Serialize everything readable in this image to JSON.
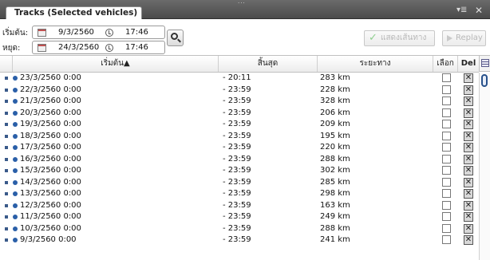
{
  "window": {
    "tab_title": "Tracks (Selected vehicles)",
    "grip": "...",
    "tab_menu_icon": "▾≣",
    "close_icon": "✕"
  },
  "filter": {
    "start_label": "เริ่มต้น:",
    "start_date": "9/3/2560",
    "start_time": "17:46",
    "end_label": "หยุด:",
    "end_date": "24/3/2560",
    "end_time": "17:46"
  },
  "toolbar": {
    "show_path_label": "แสดงเส้นทาง",
    "replay_label": "Replay"
  },
  "grid": {
    "columns": {
      "start": "เริ่มต้น▲",
      "end": "สิ้นสุด",
      "distance": "ระยะทาง",
      "select": "เลือก",
      "delete": "Del"
    },
    "del_glyph": "✕",
    "rows": [
      {
        "start": "23/3/2560 0:00",
        "end": "- 20:11",
        "distance": "283 km"
      },
      {
        "start": "22/3/2560 0:00",
        "end": "- 23:59",
        "distance": "228 km"
      },
      {
        "start": "21/3/2560 0:00",
        "end": "- 23:59",
        "distance": "328 km"
      },
      {
        "start": "20/3/2560 0:00",
        "end": "- 23:59",
        "distance": "206 km"
      },
      {
        "start": "19/3/2560 0:00",
        "end": "- 23:59",
        "distance": "209 km"
      },
      {
        "start": "18/3/2560 0:00",
        "end": "- 23:59",
        "distance": "195 km"
      },
      {
        "start": "17/3/2560 0:00",
        "end": "- 23:59",
        "distance": "220 km"
      },
      {
        "start": "16/3/2560 0:00",
        "end": "- 23:59",
        "distance": "288 km"
      },
      {
        "start": "15/3/2560 0:00",
        "end": "- 23:59",
        "distance": "302 km"
      },
      {
        "start": "14/3/2560 0:00",
        "end": "- 23:59",
        "distance": "285 km"
      },
      {
        "start": "13/3/2560 0:00",
        "end": "- 23:59",
        "distance": "298 km"
      },
      {
        "start": "12/3/2560 0:00",
        "end": "- 23:59",
        "distance": "163 km"
      },
      {
        "start": "11/3/2560 0:00",
        "end": "- 23:59",
        "distance": "249 km"
      },
      {
        "start": "10/3/2560 0:00",
        "end": "- 23:59",
        "distance": "288 km"
      },
      {
        "start": "9/3/2560 0:00",
        "end": "- 23:59",
        "distance": "241 km"
      }
    ]
  }
}
